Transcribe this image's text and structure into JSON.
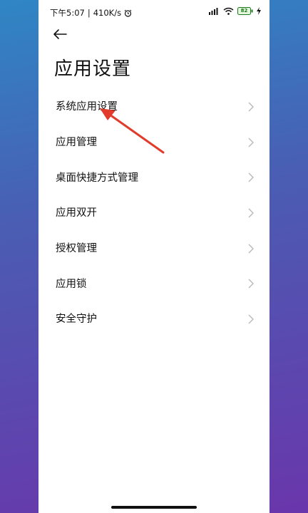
{
  "status_bar": {
    "time": "下午5:07",
    "separator": "|",
    "speed": "410K/s",
    "battery": "82"
  },
  "page": {
    "title": "应用设置"
  },
  "menu": [
    {
      "label": "系统应用设置"
    },
    {
      "label": "应用管理"
    },
    {
      "label": "桌面快捷方式管理"
    },
    {
      "label": "应用双开"
    },
    {
      "label": "授权管理"
    },
    {
      "label": "应用锁"
    },
    {
      "label": "安全守护"
    }
  ],
  "colors": {
    "annotation_arrow": "#e23b2b",
    "text": "#111111",
    "chevron": "#b5b5b5"
  }
}
